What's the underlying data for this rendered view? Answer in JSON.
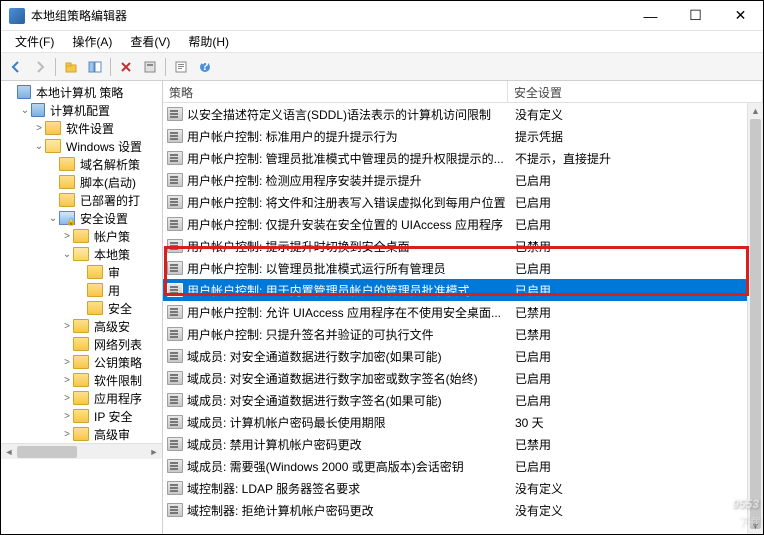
{
  "window": {
    "title": "本地组策略编辑器"
  },
  "menu": {
    "file": "文件(F)",
    "action": "操作(A)",
    "view": "查看(V)",
    "help": "帮助(H)"
  },
  "toolbar": {
    "back": "back",
    "forward": "forward",
    "up": "up",
    "show": "show",
    "delete": "delete",
    "export": "export",
    "help": "help",
    "props": "props"
  },
  "tree": {
    "root": "本地计算机 策略",
    "computer_config": "计算机配置",
    "software_settings": "软件设置",
    "windows_settings": "Windows 设置",
    "name_resolution": "域名解析策",
    "scripts": "脚本(启动)",
    "deployed_printers": "已部署的打",
    "security_settings": "安全设置",
    "account_policies": "帐户策",
    "local_policies": "本地策",
    "audit": "审",
    "user_rights": "用",
    "security_options": "安全",
    "advanced_security": "高级安",
    "network_list": "网络列表",
    "public_key": "公钥策略",
    "software_restriction": "软件限制",
    "application_control": "应用程序",
    "ip_security": "IP 安全",
    "advanced_audit": "高级审"
  },
  "columns": {
    "policy": "策略",
    "security_setting": "安全设置"
  },
  "rows": [
    {
      "policy": "以安全描述符定义语言(SDDL)语法表示的计算机访问限制",
      "setting": "没有定义"
    },
    {
      "policy": "用户帐户控制: 标准用户的提升提示行为",
      "setting": "提示凭据"
    },
    {
      "policy": "用户帐户控制: 管理员批准模式中管理员的提升权限提示的...",
      "setting": "不提示，直接提升"
    },
    {
      "policy": "用户帐户控制: 检测应用程序安装并提示提升",
      "setting": "已启用"
    },
    {
      "policy": "用户帐户控制: 将文件和注册表写入错误虚拟化到每用户位置",
      "setting": "已启用"
    },
    {
      "policy": "用户帐户控制: 仅提升安装在安全位置的 UIAccess 应用程序",
      "setting": "已启用"
    },
    {
      "policy": "用户帐户控制: 提示提升时切换到安全桌面",
      "setting": "已禁用"
    },
    {
      "policy": "用户帐户控制: 以管理员批准模式运行所有管理员",
      "setting": "已启用"
    },
    {
      "policy": "用户帐户控制: 用于内置管理员帐户的管理员批准模式",
      "setting": "已启用",
      "selected": true
    },
    {
      "policy": "用户帐户控制: 允许 UIAccess 应用程序在不使用安全桌面...",
      "setting": "已禁用"
    },
    {
      "policy": "用户帐户控制: 只提升签名并验证的可执行文件",
      "setting": "已禁用"
    },
    {
      "policy": "域成员: 对安全通道数据进行数字加密(如果可能)",
      "setting": "已启用"
    },
    {
      "policy": "域成员: 对安全通道数据进行数字加密或数字签名(始终)",
      "setting": "已启用"
    },
    {
      "policy": "域成员: 对安全通道数据进行数字签名(如果可能)",
      "setting": "已启用"
    },
    {
      "policy": "域成员: 计算机帐户密码最长使用期限",
      "setting": "30 天"
    },
    {
      "policy": "域成员: 禁用计算机帐户密码更改",
      "setting": "已禁用"
    },
    {
      "policy": "域成员: 需要强(Windows 2000 或更高版本)会话密钥",
      "setting": "已启用"
    },
    {
      "policy": "域控制器: LDAP 服务器签名要求",
      "setting": "没有定义"
    },
    {
      "policy": "域控制器: 拒绝计算机帐户密码更改",
      "setting": "没有定义"
    }
  ],
  "watermark": {
    "main": "9553",
    "sub": "下载"
  }
}
